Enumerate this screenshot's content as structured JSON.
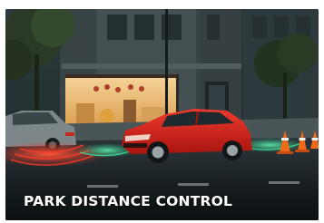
{
  "caption": "PARK DISTANCE CONTROL",
  "colors": {
    "caption_text": "#ffffff",
    "car_red": "#d9271f",
    "sensor_glow_red": "#ff3b2a",
    "sensor_glow_green": "#3fe0a0",
    "traffic_cone": "#f06a1a",
    "shop_window_warm": "#f2c27a"
  },
  "image_content": {
    "main_subject": "red hatchback car",
    "other_objects": [
      "grey parked car",
      "traffic cones",
      "lit shop window",
      "street trees",
      "street lamp"
    ]
  }
}
